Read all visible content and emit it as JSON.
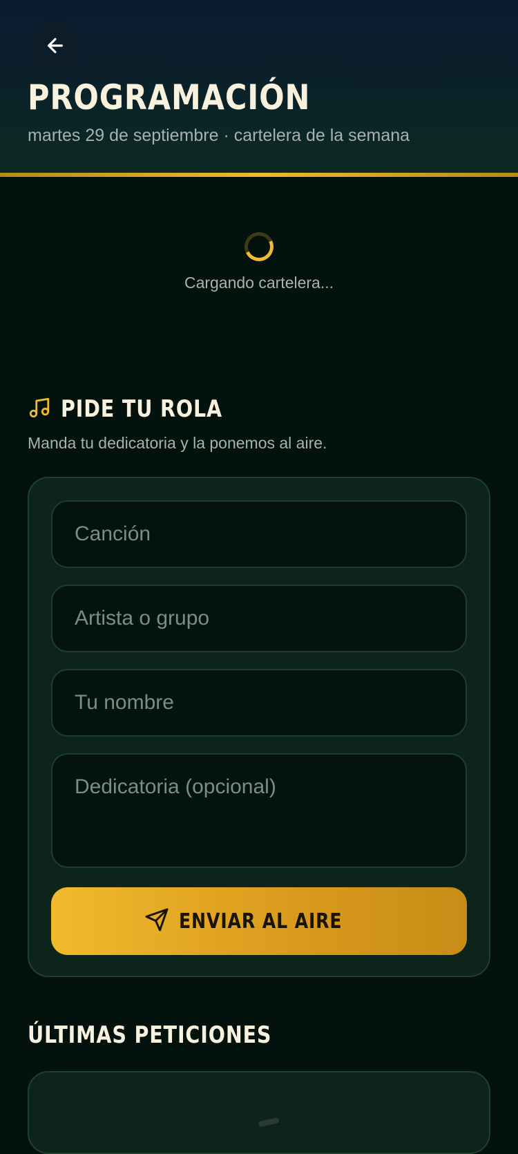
{
  "header": {
    "back_icon": "arrow-left-icon",
    "title": "PROGRAMACIÓN",
    "subtitle": "martes 29 de septiembre · cartelera de la semana"
  },
  "loader": {
    "text": "Cargando cartelera..."
  },
  "request_section": {
    "icon": "music-note-icon",
    "title": "PIDE TU ROLA",
    "description": "Manda tu dedicatoria y la ponemos al aire.",
    "fields": {
      "song_placeholder": "Canción",
      "artist_placeholder": "Artista o grupo",
      "name_placeholder": "Tu nombre",
      "dedication_placeholder": "Dedicatoria (opcional)"
    },
    "submit_icon": "send-icon",
    "submit_label": "ENVIAR AL AIRE"
  },
  "recent_section": {
    "title": "ÚLTIMAS PETICIONES"
  },
  "colors": {
    "accent": "#f0b92e",
    "background": "#04120d",
    "card": "#0c2419"
  }
}
